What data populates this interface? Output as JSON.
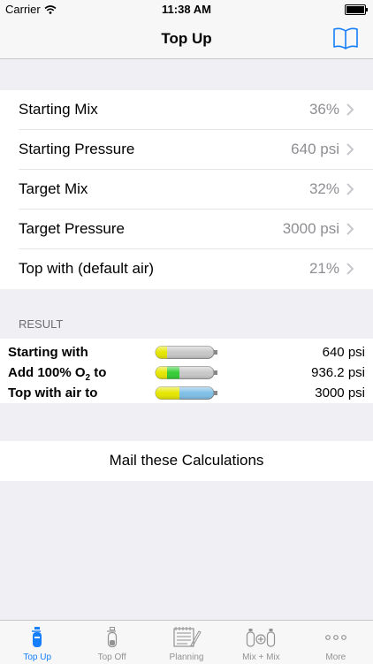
{
  "status_bar": {
    "carrier": "Carrier",
    "time": "11:38 AM"
  },
  "nav": {
    "title": "Top Up",
    "book_icon": "book-icon"
  },
  "inputs": [
    {
      "label": "Starting Mix",
      "value": "36%"
    },
    {
      "label": "Starting Pressure",
      "value": "640 psi"
    },
    {
      "label": "Target Mix",
      "value": "32%"
    },
    {
      "label": "Target Pressure",
      "value": "3000 psi"
    },
    {
      "label": "Top with (default air)",
      "value": "21%"
    }
  ],
  "result": {
    "header": "RESULT",
    "rows": [
      {
        "label": "Starting with",
        "value": "640 psi"
      },
      {
        "label": "Add 100% O₂ to",
        "value": "936.2 psi"
      },
      {
        "label": "Top with air to",
        "value": "3000 psi"
      }
    ]
  },
  "mail_button": "Mail these Calculations",
  "tabs": [
    {
      "label": "Top Up",
      "icon": "tank-icon",
      "active": true
    },
    {
      "label": "Top Off",
      "icon": "tank-outline-icon",
      "active": false
    },
    {
      "label": "Planning",
      "icon": "notepad-icon",
      "active": false
    },
    {
      "label": "Mix + Mix",
      "icon": "mix-tanks-icon",
      "active": false
    },
    {
      "label": "More",
      "icon": "more-icon",
      "active": false
    }
  ],
  "colors": {
    "accent": "#147efb",
    "nitrox_yellow": "#e6e600",
    "oxygen_green": "#33cc33",
    "air_blue": "#7fbfe6"
  }
}
